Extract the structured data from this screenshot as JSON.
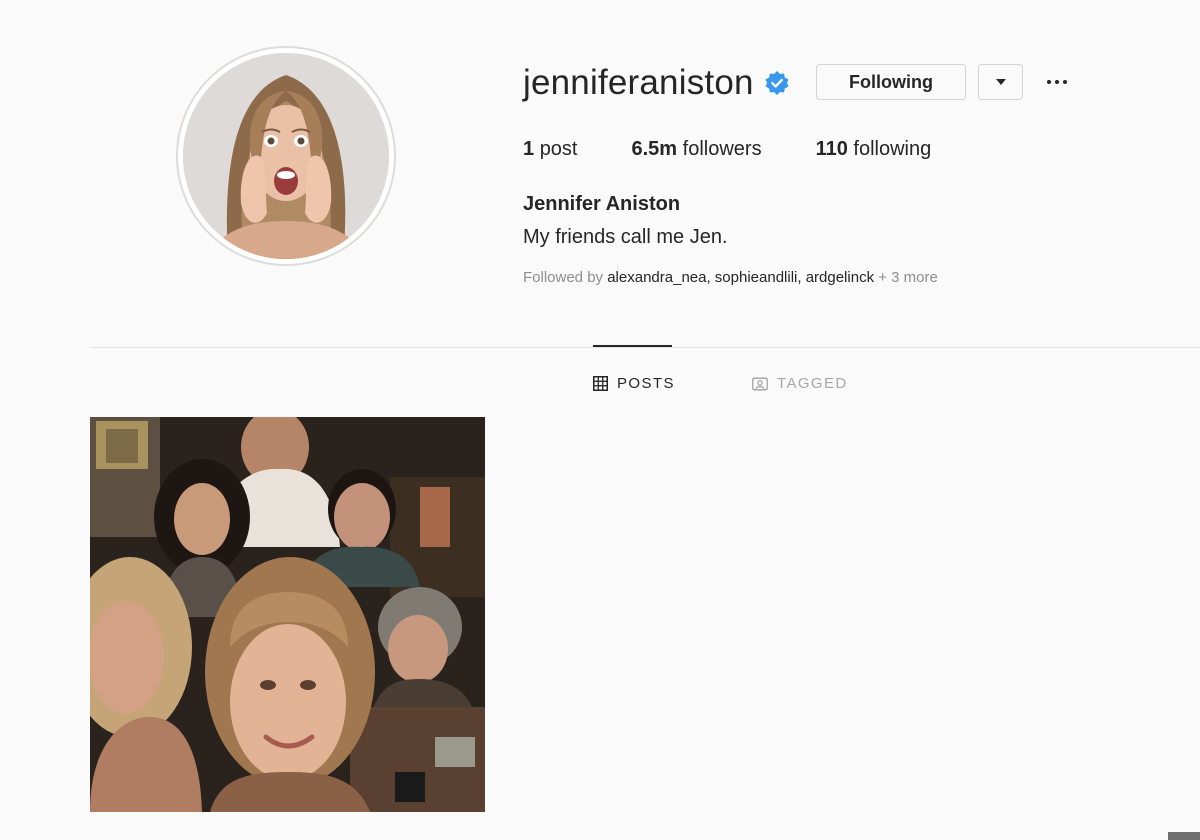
{
  "profile": {
    "username": "jenniferaniston",
    "verified": true,
    "following_label": "Following",
    "stats": {
      "posts_count": "1",
      "posts_label": "post",
      "followers_count": "6.5m",
      "followers_label": "followers",
      "following_count": "110",
      "following_label": "following"
    },
    "full_name": "Jennifer Aniston",
    "bio": "My friends call me Jen.",
    "followed_by": {
      "prefix": "Followed by",
      "names": "alexandra_nea, sophieandlili, ardgelinck",
      "more": "+ 3 more"
    }
  },
  "tabs": [
    {
      "label": "POSTS",
      "icon": "grid-icon",
      "active": true
    },
    {
      "label": "TAGGED",
      "icon": "tagged-icon",
      "active": false
    }
  ],
  "posts": [
    {
      "type": "photo",
      "description_icon": "group-selfie-photo"
    }
  ],
  "colors": {
    "background": "#fafafa",
    "text": "#262626",
    "muted": "#8e8e8e",
    "verified_blue": "#3897f0",
    "border": "#dbdbdb"
  }
}
